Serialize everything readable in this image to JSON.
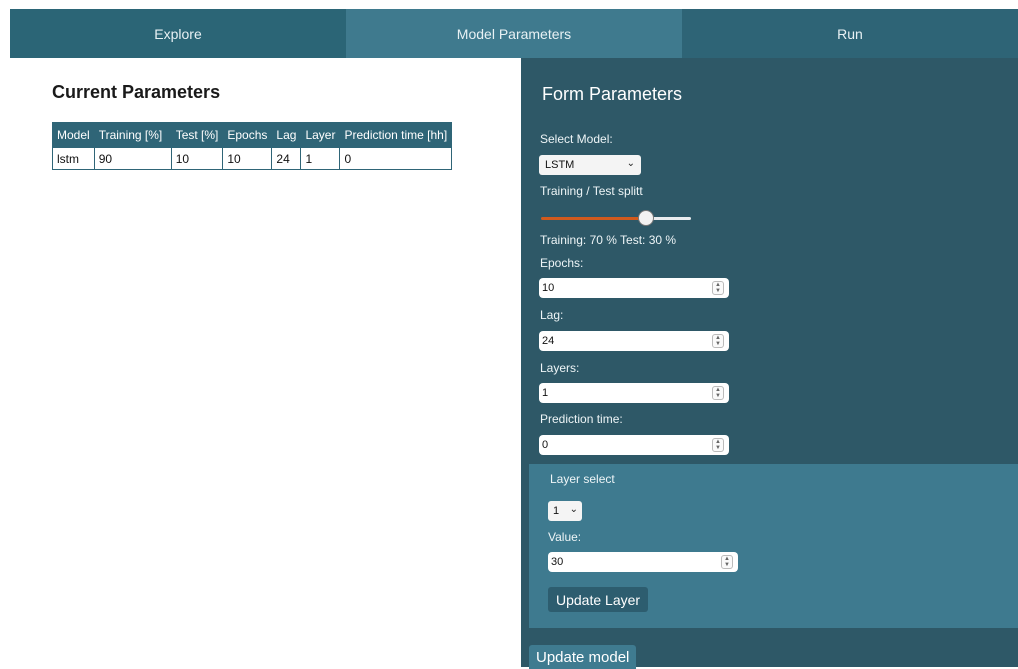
{
  "tabs": [
    {
      "label": "Explore"
    },
    {
      "label": "Model Parameters"
    },
    {
      "label": "Run"
    }
  ],
  "current": {
    "title": "Current Parameters",
    "headers": [
      "Model",
      "Training [%]",
      "Test [%]",
      "Epochs",
      "Lag",
      "Layer",
      "Prediction time [hh]"
    ],
    "row": [
      "lstm",
      "90",
      "10",
      "10",
      "24",
      "1",
      "0"
    ]
  },
  "form": {
    "title": "Form Parameters",
    "select_model_label": "Select Model:",
    "model_value": "LSTM",
    "split_label": "Training / Test splitt",
    "split_fraction": 0.7,
    "split_text": "Training: 70 % Test: 30 %",
    "epochs_label": "Epochs:",
    "epochs_value": "10",
    "lag_label": "Lag:",
    "lag_value": "24",
    "layers_label": "Layers:",
    "layers_value": "1",
    "prediction_label": "Prediction time:",
    "prediction_value": "0"
  },
  "layer": {
    "select_label": "Layer select",
    "select_value": "1",
    "value_label": "Value:",
    "value": "30",
    "update_label": "Update Layer"
  },
  "update_model_label": "Update model",
  "colors": {
    "accent": "#d15a1d",
    "panel": "#2e5867",
    "tab_active": "#3f7a8e"
  }
}
